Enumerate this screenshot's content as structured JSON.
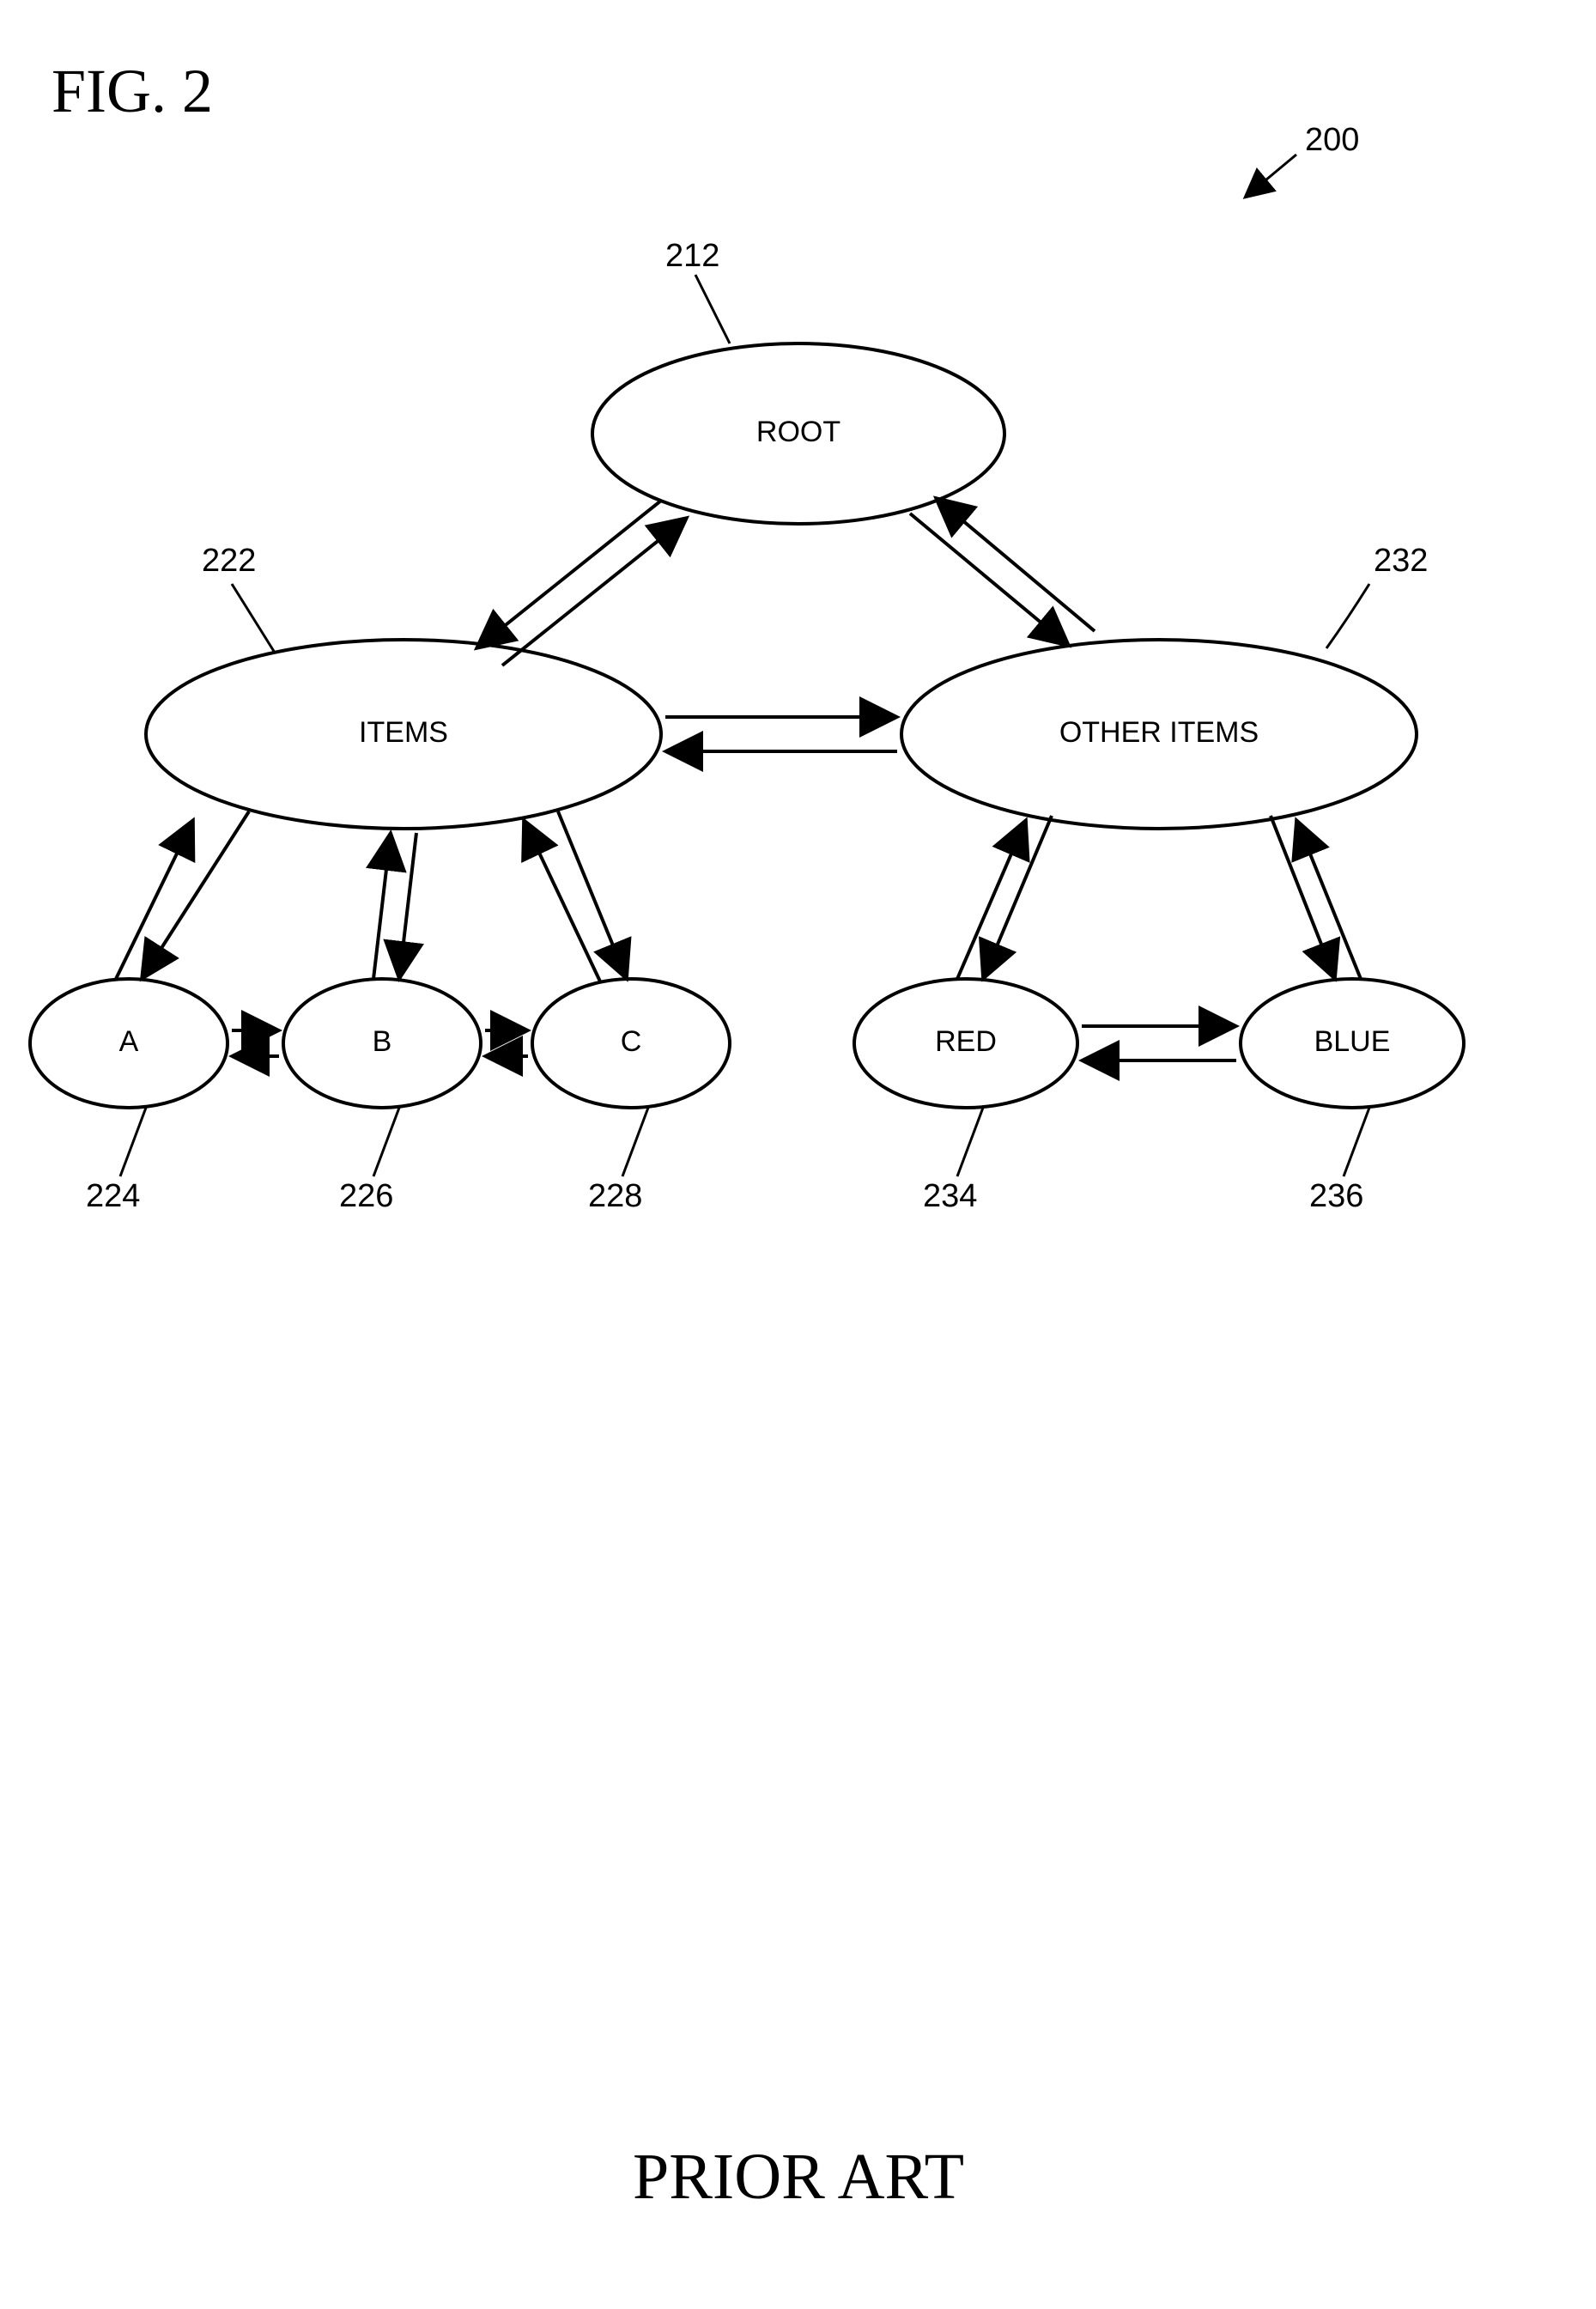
{
  "figure_title": "FIG. 2",
  "footer": "PRIOR ART",
  "diagram_ref": "200",
  "nodes": {
    "root": {
      "label": "ROOT",
      "ref": "212"
    },
    "items": {
      "label": "ITEMS",
      "ref": "222"
    },
    "other": {
      "label": "OTHER ITEMS",
      "ref": "232"
    },
    "a": {
      "label": "A",
      "ref": "224"
    },
    "b": {
      "label": "B",
      "ref": "226"
    },
    "c": {
      "label": "C",
      "ref": "228"
    },
    "red": {
      "label": "RED",
      "ref": "234"
    },
    "blue": {
      "label": "BLUE",
      "ref": "236"
    }
  }
}
